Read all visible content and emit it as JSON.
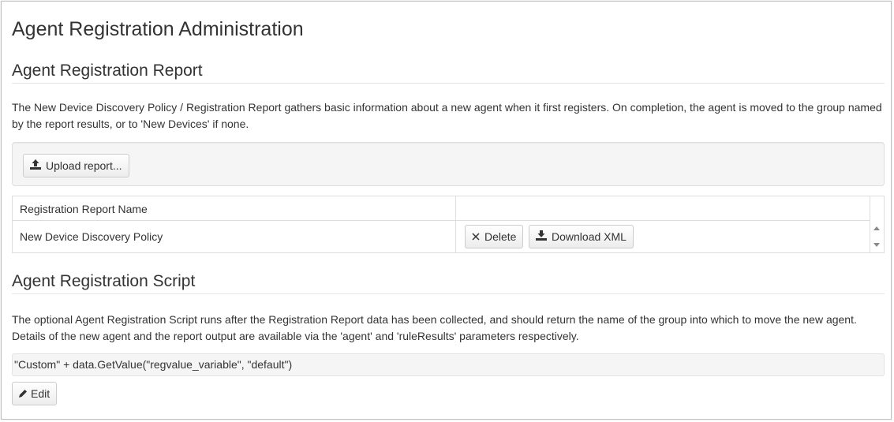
{
  "page": {
    "title": "Agent Registration Administration"
  },
  "report_section": {
    "title": "Agent Registration Report",
    "description": "The New Device Discovery Policy / Registration Report gathers basic information about a new agent when it first registers. On completion, the agent is moved to the group named by the report results, or to 'New Devices' if none.",
    "upload_button_label": "Upload report...",
    "table": {
      "columns": [
        "Registration Report Name",
        ""
      ],
      "rows": [
        {
          "name": "New Device Discovery Policy",
          "delete_label": "Delete",
          "download_label": "Download XML"
        }
      ]
    }
  },
  "script_section": {
    "title": "Agent Registration Script",
    "description": "The optional Agent Registration Script runs after the Registration Report data has been collected, and should return the name of the group into which to move the new agent. Details of the new agent and the report output are available via the 'agent' and 'ruleResults' parameters respectively.",
    "script_value": "\"Custom\" + data.GetValue(\"regvalue_variable\", \"default\")",
    "edit_button_label": "Edit"
  },
  "icons": {
    "upload": "upload-icon",
    "delete": "close-icon",
    "download": "download-icon",
    "edit": "pencil-icon"
  },
  "colors": {
    "text": "#333333",
    "well_background": "#f5f5f5",
    "border": "#dddddd"
  }
}
